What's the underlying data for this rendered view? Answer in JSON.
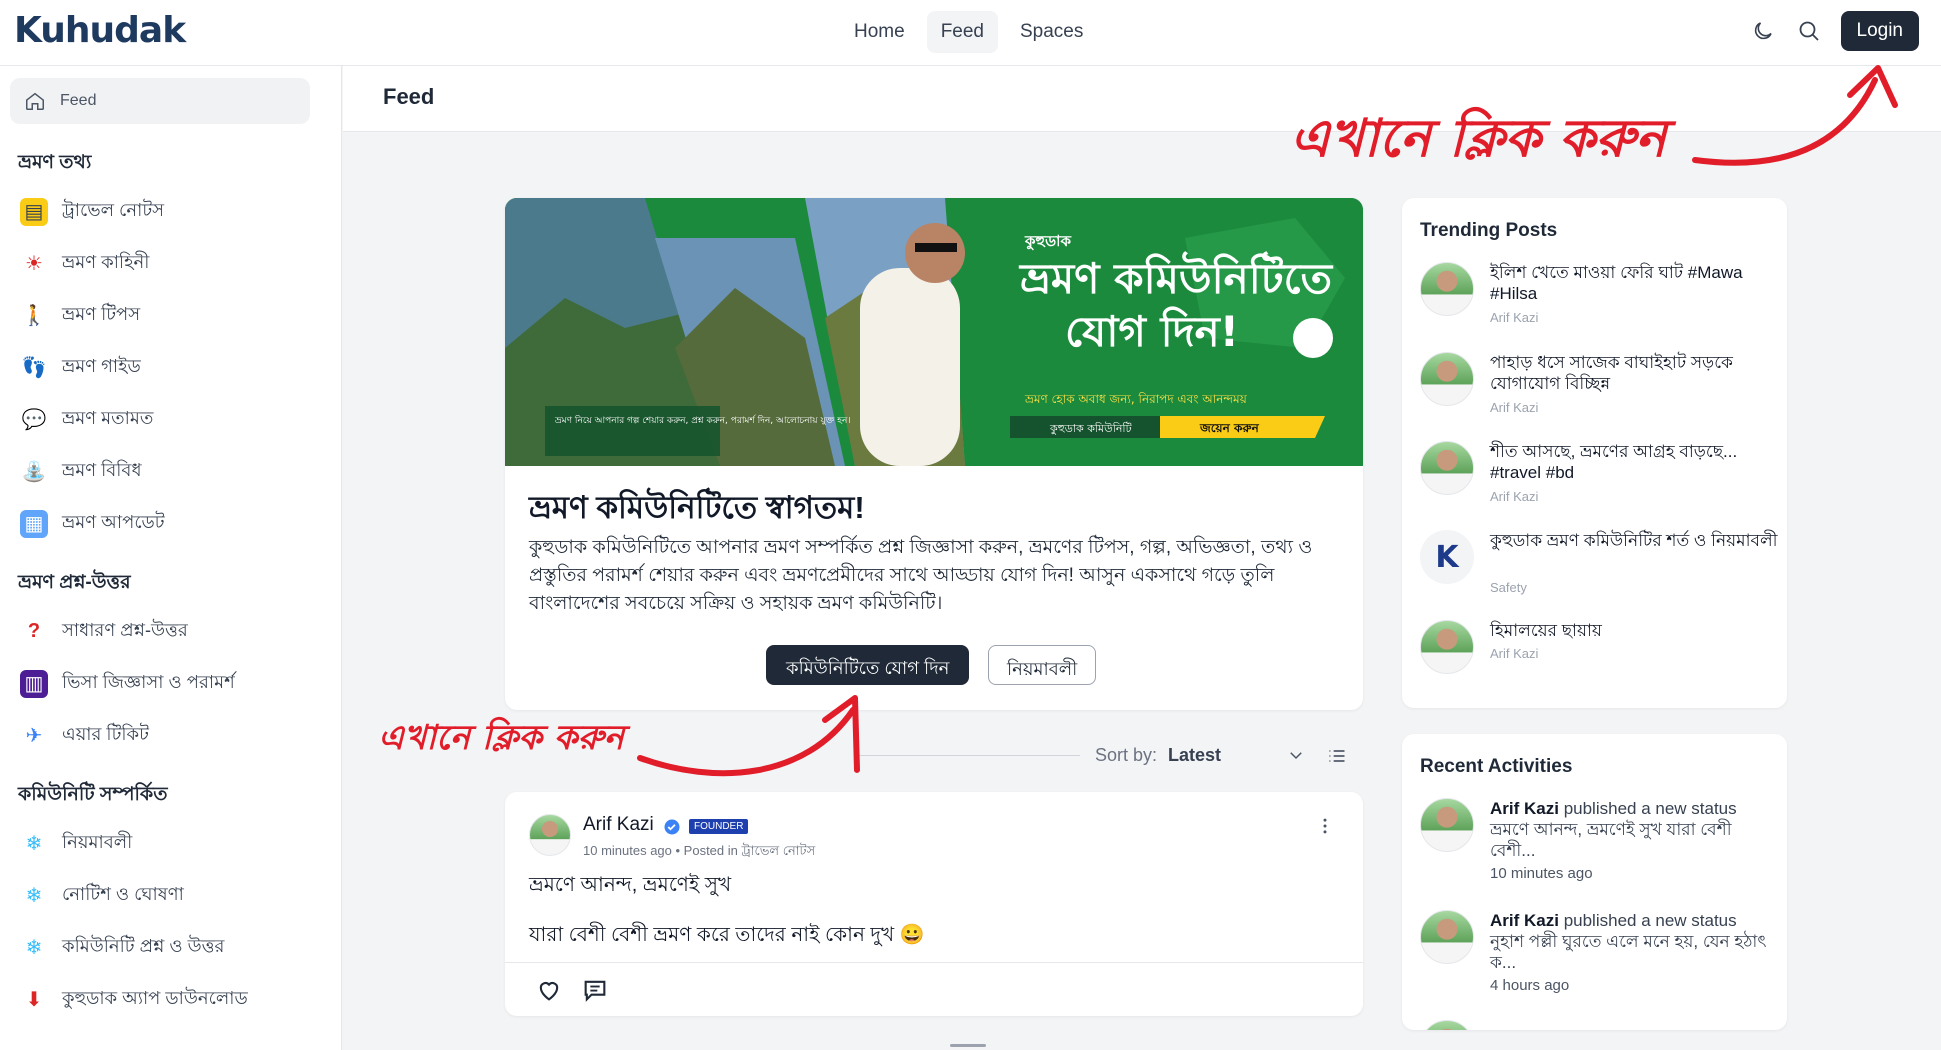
{
  "header": {
    "logo": "Kuhudak",
    "nav": [
      "Home",
      "Feed",
      "Spaces"
    ],
    "login_label": "Login"
  },
  "sidebar": {
    "feed_label": "Feed",
    "sections": [
      {
        "title": "ভ্রমণ তথ্য",
        "items": [
          {
            "icon": "notebook-icon",
            "label": "ট্রাভেল নোটস"
          },
          {
            "icon": "sun-hand-icon",
            "label": "ভ্রমণ কাহিনী"
          },
          {
            "icon": "walker-icon",
            "label": "ভ্রমণ টিপস"
          },
          {
            "icon": "footprints-icon",
            "label": "ভ্রমণ গাইড"
          },
          {
            "icon": "speech-bubble-icon",
            "label": "ভ্রমণ মতামত"
          },
          {
            "icon": "slide-icon",
            "label": "ভ্রমণ বিবিধ"
          },
          {
            "icon": "map-icon",
            "label": "ভ্রমণ আপডেট"
          }
        ]
      },
      {
        "title": "ভ্রমণ প্রশ্ন-উত্তর",
        "items": [
          {
            "icon": "question-icon",
            "label": "সাধারণ প্রশ্ন-উত্তর"
          },
          {
            "icon": "building-icon",
            "label": "ভিসা জিজ্ঞাসা ও পরামর্শ"
          },
          {
            "icon": "airplane-icon",
            "label": "এয়ার টিকিট"
          }
        ]
      },
      {
        "title": "কমিউনিটি সম্পর্কিত",
        "items": [
          {
            "icon": "snowflake-icon",
            "label": "নিয়মাবলী"
          },
          {
            "icon": "snowflake-icon",
            "label": "নোটিশ ও ঘোষণা"
          },
          {
            "icon": "snowflake-icon",
            "label": "কমিউনিটি প্রশ্ন ও উত্তর"
          },
          {
            "icon": "download-icon",
            "label": "কুহুডাক অ্যাপ ডাউনলোড"
          }
        ]
      }
    ]
  },
  "main": {
    "page_title": "Feed",
    "banner": {
      "brand": "কুহুডাক",
      "headline_1": "ভ্রমণ কমিউনিটিতে",
      "headline_2": "যোগ দিন!",
      "tagline": "ভ্রমণ হোক অবাধ জন্য, নিরাপদ এবং আনন্দময়",
      "strip_left": "কুহুডাক কমিউনিটি",
      "strip_right": "জয়েন করুন",
      "left_caption": "ভ্রমণ নিয়ে আপনার গল্প শেয়ার করুন, প্রশ্ন করুন, পরামর্শ দিন, আলোচনায় যুক্ত হন।"
    },
    "welcome_title": "ভ্রমণ কমিউনিটিতে স্বাগতম!",
    "welcome_text": "কুহুডাক কমিউনিটিতে আপনার ভ্রমণ সম্পর্কিত প্রশ্ন জিজ্ঞাসা করুন, ভ্রমণের টিপস, গল্প, অভিজ্ঞতা, তথ্য ও প্রস্তুতির পরামর্শ শেয়ার করুন এবং ভ্রমণপ্রেমীদের সাথে আড্ডায় যোগ দিন! আসুন একসাথে গড়ে তুলি বাংলাদেশের সবচেয়ে সক্রিয় ও সহায়ক ভ্রমণ কমিউনিটি।",
    "join_button": "কমিউনিটিতে যোগ দিন",
    "rules_button": "নিয়মাবলী",
    "sort_label": "Sort by:",
    "sort_value": "Latest",
    "post": {
      "author": "Arif Kazi",
      "badge": "FOUNDER",
      "meta": "10 minutes ago • Posted in ট্রাভেল নোটস",
      "line1": "ভ্রমণে আনন্দ, ভ্রমণেই সুখ",
      "line2": "যারা বেশী বেশী ভ্রমণ করে তাদের নাই কোন দুখ 😀"
    }
  },
  "trending": {
    "title": "Trending Posts",
    "items": [
      {
        "text": "ইলিশ খেতে মাওয়া ফেরি ঘাট #Mawa #Hilsa",
        "author": "Arif Kazi"
      },
      {
        "text": "পাহাড় ধসে সাজেক বাঘাইহাট সড়কে যোগাযোগ বিচ্ছিন্ন",
        "author": "Arif Kazi"
      },
      {
        "text": "শীত আসছে, ভ্রমণের আগ্রহ বাড়ছে... #travel #bd",
        "author": "Arif Kazi"
      },
      {
        "text": "কুহুডাক ভ্রমণ কমিউনিটির শর্ত ও নিয়মাবলী",
        "author": "Safety"
      },
      {
        "text": "হিমালয়ের ছায়ায়",
        "author": "Arif Kazi"
      }
    ]
  },
  "activities": {
    "title": "Recent Activities",
    "items": [
      {
        "author": "Arif Kazi",
        "action": " published a new status",
        "excerpt": "ভ্রমণে আনন্দ, ভ্রমণেই সুখ যারা বেশী বেশী...",
        "time": "10 minutes ago"
      },
      {
        "author": "Arif Kazi",
        "action": " published a new status",
        "excerpt": "নুহাশ পল্লী ঘুরতে এলে মনে হয়, যেন হঠাৎ ক...",
        "time": "4 hours ago"
      }
    ]
  },
  "annotations": {
    "top": "এখানে ক্লিক করুন",
    "middle": "এখানে ক্লিক করুন"
  },
  "colors": {
    "annotation": "#e11d2a",
    "banner_green": "#1b8a3d",
    "primary_dark": "#1f2937"
  }
}
